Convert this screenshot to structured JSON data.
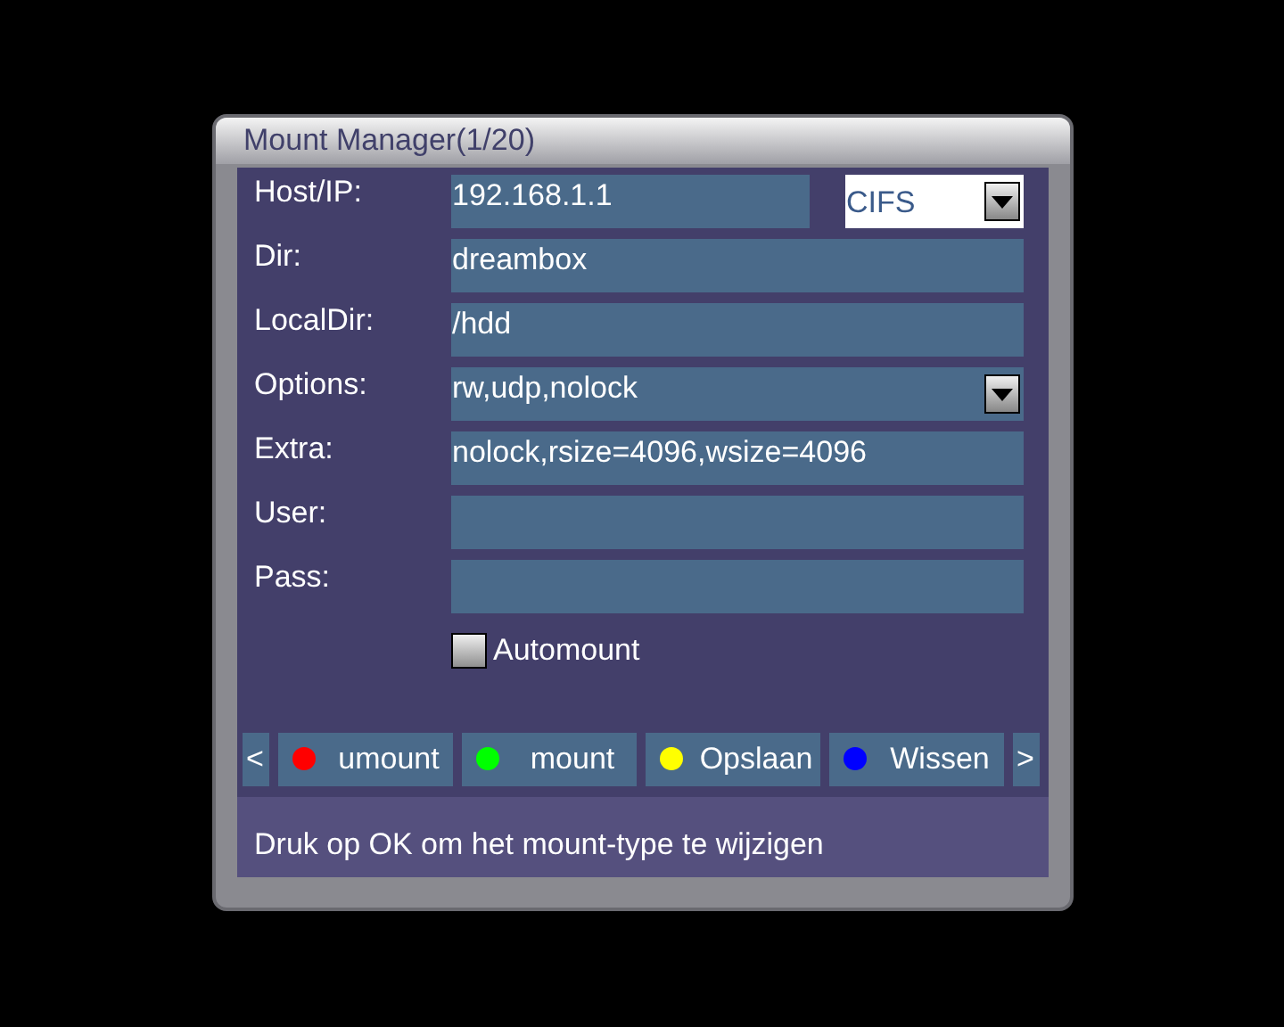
{
  "window": {
    "title": "Mount Manager(1/20)"
  },
  "fields": [
    {
      "label": "Host/IP:",
      "kind": "text",
      "value": "192.168.1.1",
      "selected": false,
      "type_select": {
        "value": "CIFS",
        "selected": true
      }
    },
    {
      "label": "Dir:",
      "kind": "text",
      "value": "dreambox",
      "selected": false
    },
    {
      "label": "LocalDir:",
      "kind": "text",
      "value": "/hdd",
      "selected": false
    },
    {
      "label": "Options:",
      "kind": "select",
      "value": "rw,udp,nolock",
      "selected": false
    },
    {
      "label": "Extra:",
      "kind": "text",
      "value": "nolock,rsize=4096,wsize=4096",
      "selected": false
    },
    {
      "label": "User:",
      "kind": "text",
      "selected": false
    },
    {
      "label": "Pass:",
      "kind": "text",
      "selected": false
    }
  ],
  "automount": {
    "label": "Automount",
    "checked": false
  },
  "buttons": {
    "prev": "<",
    "next": ">",
    "items": [
      {
        "label": "umount",
        "color": "#ff0000"
      },
      {
        "label": "mount",
        "color": "#00ff00"
      },
      {
        "label": "Opslaan",
        "color": "#ffff00"
      },
      {
        "label": "Wissen",
        "color": "#0000ff"
      }
    ]
  },
  "hint": "Druk op OK om het mount-type te wijzigen"
}
